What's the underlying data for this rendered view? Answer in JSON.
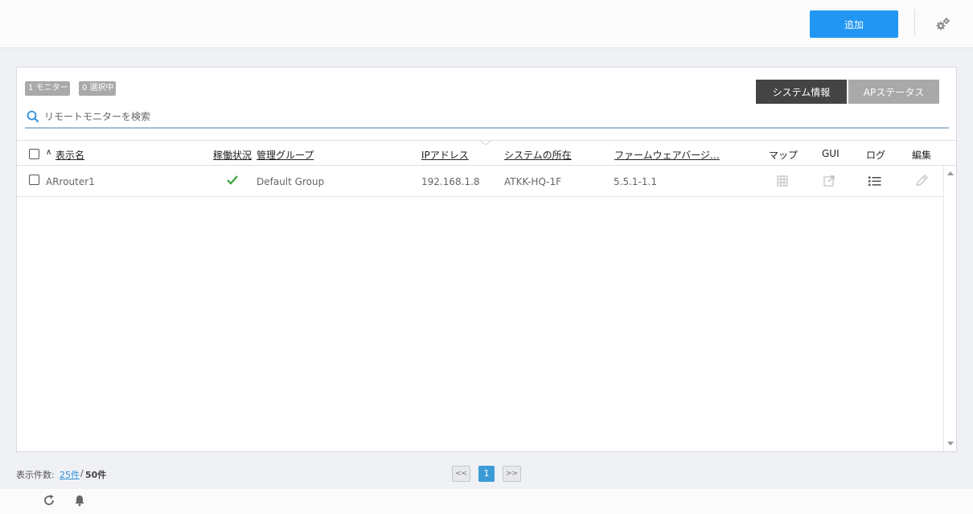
{
  "header": {
    "add_label": "追加"
  },
  "panel": {
    "monitor_badge": "1 モニター",
    "selected_badge": "0 選択中",
    "tabs": [
      {
        "label": "システム情報",
        "active": true
      },
      {
        "label": "APステータス",
        "active": false
      }
    ],
    "search_placeholder": "リモートモニターを検索"
  },
  "table": {
    "columns": {
      "name": "表示名",
      "status": "稼働状況",
      "group": "管理グループ",
      "ip": "IPアドレス",
      "location": "システムの所在",
      "firmware": "ファームウェアバージ…",
      "map": "マップ",
      "gui": "GUI",
      "log": "ログ",
      "edit": "編集"
    },
    "rows": [
      {
        "name": "ARrouter1",
        "status_icon": "check-icon",
        "group": "Default Group",
        "ip": "192.168.1.8",
        "location": "ATKK-HQ-1F",
        "firmware": "5.5.1-1.1"
      }
    ]
  },
  "footer": {
    "count_label": "表示件数:",
    "page_size": "25件",
    "separator": "/",
    "total": "50件",
    "prev_label": "<<",
    "current_page": "1",
    "next_label": ">>"
  },
  "colors": {
    "accent": "#2196f3",
    "status_ok": "#3aa33a",
    "active_tab": "#444444",
    "page_current": "#3b9bd6"
  },
  "icons": [
    "gear-icon",
    "search-icon",
    "check-icon",
    "map-grid-icon",
    "external-link-icon",
    "list-icon",
    "pencil-icon",
    "refresh-icon",
    "bell-icon"
  ]
}
